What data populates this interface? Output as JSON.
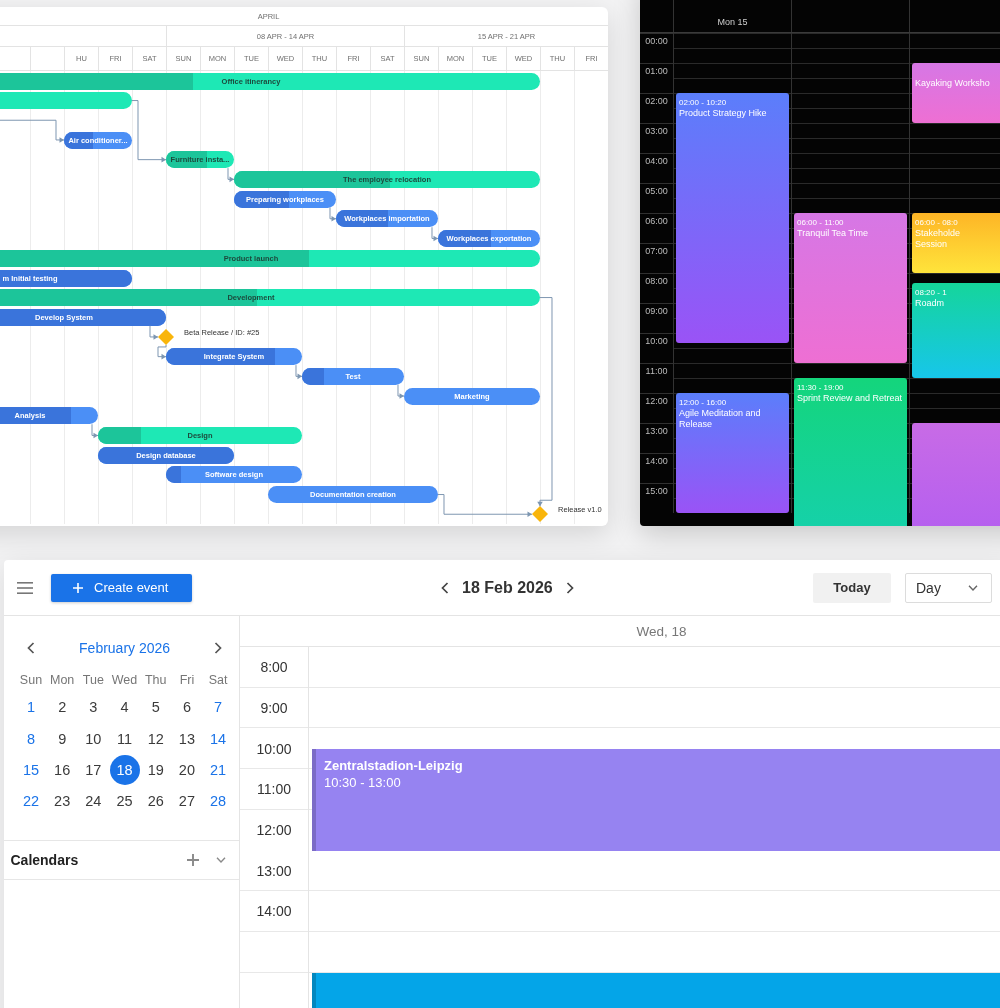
{
  "gantt": {
    "month": "APRIL",
    "weeks": [
      "08 APR - 14 APR",
      "15 APR - 21 APR"
    ],
    "days": [
      "HU",
      "FRI",
      "SAT",
      "SUN",
      "MON",
      "TUE",
      "WED",
      "THU",
      "FRI",
      "SAT",
      "SUN",
      "MON",
      "TUE",
      "WED",
      "THU",
      "FRI"
    ],
    "tasks": [
      {
        "kind": "project",
        "label": "Office itinerancy",
        "level": 0.4
      },
      {
        "kind": "project"
      },
      {
        "kind": "task",
        "label": "Air conditioner...",
        "level": 0.43
      },
      {
        "kind": "project",
        "label": "Furniture insta...",
        "level": 0.61
      },
      {
        "kind": "project",
        "label": "The employee relocation",
        "level": 0.51
      },
      {
        "kind": "task",
        "label": "Preparing workplaces",
        "level": 0.54
      },
      {
        "kind": "task",
        "label": "Workplaces importation",
        "level": 0.51
      },
      {
        "kind": "task",
        "label": "Workplaces exportation",
        "level": 0.52
      },
      {
        "kind": "project",
        "label": "Product launch",
        "level": 0.6
      },
      {
        "kind": "task",
        "label": "m Initial testing",
        "level": 1
      },
      {
        "kind": "project",
        "label": "Development",
        "level": 0.51
      },
      {
        "kind": "task",
        "label": "Develop System",
        "level": 1
      },
      {
        "kind": "milestone",
        "label": "Beta Release / ID: #25"
      },
      {
        "kind": "task",
        "label": "Integrate System",
        "level": 0.8
      },
      {
        "kind": "task",
        "label": "Test",
        "level": 0.22
      },
      {
        "kind": "task",
        "label": "Marketing"
      },
      {
        "kind": "task",
        "label": "Analysis",
        "level": 0.8
      },
      {
        "kind": "project",
        "label": "Design",
        "level": 0.21
      },
      {
        "kind": "task",
        "label": "Design database",
        "level": 1
      },
      {
        "kind": "task",
        "label": "Software design",
        "level": 0.11
      },
      {
        "kind": "task",
        "label": "Documentation creation"
      },
      {
        "kind": "milestone",
        "label": "Release v1.0"
      }
    ]
  },
  "scheduler": {
    "column_header": "Mon 15",
    "hours": [
      "00:00",
      "01:00",
      "02:00",
      "03:00",
      "04:00",
      "05:00",
      "06:00",
      "07:00",
      "08:00",
      "09:00",
      "10:00",
      "11:00",
      "12:00",
      "13:00",
      "14:00",
      "15:00"
    ],
    "events": [
      {
        "kind": "pink",
        "title": "Kayaking Worksho"
      },
      {
        "kind": "violet",
        "time": "02:00 - 10:20",
        "title": "Product Strategy Hike"
      },
      {
        "kind": "pink",
        "time": "06:00 - 11:00",
        "title": "Tranquil Tea Time"
      },
      {
        "kind": "amber",
        "time": "06:00 - 08:0",
        "title": "Stakeholde Session"
      },
      {
        "kind": "teal",
        "time": "08:20 - 1",
        "title": "Roadm"
      },
      {
        "kind": "green",
        "time": "11:30 - 19:00",
        "title": "Sprint Review and Retreat"
      },
      {
        "kind": "violet",
        "time": "12:00 - 16:00",
        "title": "Agile Meditation and Release"
      },
      {
        "kind": "magenta"
      }
    ]
  },
  "calendar": {
    "create_button": "Create event",
    "month_title": "February 2026",
    "weekdays": [
      "Sun",
      "Mon",
      "Tue",
      "Wed",
      "Thu",
      "Fri",
      "Sat"
    ],
    "days": [
      {
        "label": "1",
        "weekend": true,
        "selected": false
      },
      {
        "label": "2",
        "weekend": false,
        "selected": false
      },
      {
        "label": "3",
        "weekend": false,
        "selected": false
      },
      {
        "label": "4",
        "weekend": false,
        "selected": false
      },
      {
        "label": "5",
        "weekend": false,
        "selected": false
      },
      {
        "label": "6",
        "weekend": false,
        "selected": false
      },
      {
        "label": "7",
        "weekend": true,
        "selected": false
      },
      {
        "label": "8",
        "weekend": true,
        "selected": false
      },
      {
        "label": "9",
        "weekend": false,
        "selected": false
      },
      {
        "label": "10",
        "weekend": false,
        "selected": false
      },
      {
        "label": "11",
        "weekend": false,
        "selected": false
      },
      {
        "label": "12",
        "weekend": false,
        "selected": false
      },
      {
        "label": "13",
        "weekend": false,
        "selected": false
      },
      {
        "label": "14",
        "weekend": true,
        "selected": false
      },
      {
        "label": "15",
        "weekend": true,
        "selected": false
      },
      {
        "label": "16",
        "weekend": false,
        "selected": false
      },
      {
        "label": "17",
        "weekend": false,
        "selected": false
      },
      {
        "label": "18",
        "weekend": false,
        "selected": true
      },
      {
        "label": "19",
        "weekend": false,
        "selected": false
      },
      {
        "label": "20",
        "weekend": false,
        "selected": false
      },
      {
        "label": "21",
        "weekend": true,
        "selected": false
      },
      {
        "label": "22",
        "weekend": true,
        "selected": false
      },
      {
        "label": "23",
        "weekend": false,
        "selected": false
      },
      {
        "label": "24",
        "weekend": false,
        "selected": false
      },
      {
        "label": "25",
        "weekend": false,
        "selected": false
      },
      {
        "label": "26",
        "weekend": false,
        "selected": false
      },
      {
        "label": "27",
        "weekend": false,
        "selected": false
      },
      {
        "label": "28",
        "weekend": true,
        "selected": false
      }
    ],
    "calendars_heading": "Calendars",
    "date_title": "18 Feb 2026",
    "today_button": "Today",
    "view_select": "Day",
    "day_header": "Wed, 18",
    "hours": [
      "8:00",
      "9:00",
      "10:00",
      "11:00",
      "12:00",
      "13:00",
      "14:00"
    ],
    "events": [
      {
        "title": "Zentralstadion-Leipzig",
        "time": "10:30 - 13:00",
        "color": "#9683f1"
      },
      {
        "color": "#04a5e8"
      }
    ]
  }
}
